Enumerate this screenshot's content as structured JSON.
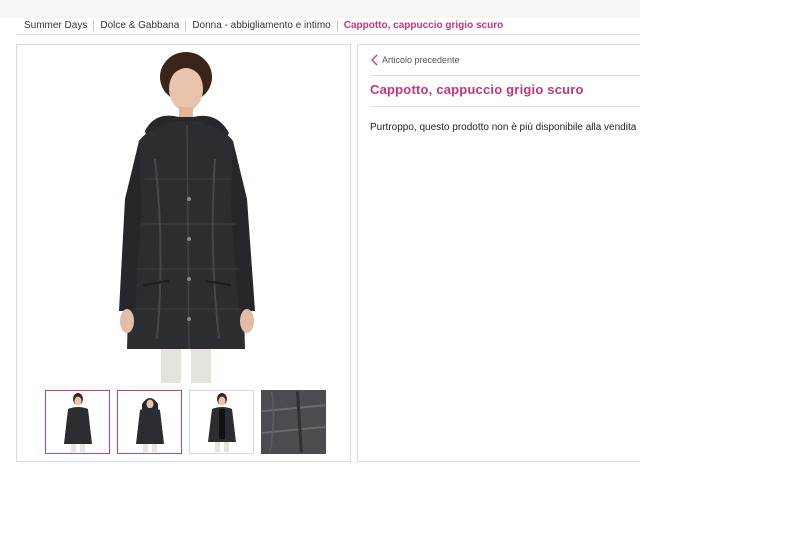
{
  "breadcrumb": {
    "items": [
      "Summer Days",
      "Dolce & Gabbana",
      "Donna - abbigliamento e intimo"
    ],
    "current": "Cappotto, cappuccio grigio scuro"
  },
  "gallery": {
    "main_image": "coat-model-front-icon",
    "thumbnails": [
      "coat-thumb-front",
      "coat-thumb-hood",
      "coat-thumb-open",
      "coat-thumb-detail"
    ],
    "selected_index": 0
  },
  "product": {
    "prev_link": "Articolo precedente",
    "title": "Cappotto, cappuccio grigio scuro",
    "availability": "Purtroppo, questo prodotto non è più disponibile alla vendita"
  },
  "colors": {
    "accent": "#c2367f",
    "border": "#dcdcdc",
    "coat": "#2b2d30"
  }
}
